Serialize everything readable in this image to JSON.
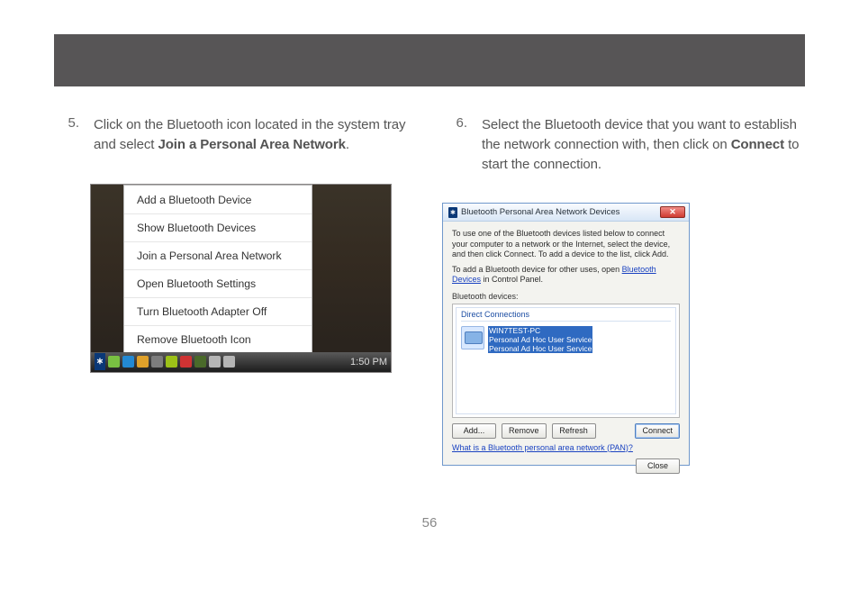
{
  "page_number": "56",
  "step5": {
    "num": "5.",
    "before": "Click on the Bluetooth icon located in the system tray and select ",
    "bold": "Join a Personal Area Network",
    "after": "."
  },
  "step6": {
    "num": "6.",
    "before": "Select the Bluetooth device that you want to establish the network connection with, then click on ",
    "bold": "Connect",
    "after": " to start the connection."
  },
  "context_menu": {
    "items": [
      "Add a Bluetooth Device",
      "Show Bluetooth Devices",
      "Join a Personal Area Network",
      "Open Bluetooth Settings",
      "Turn Bluetooth Adapter Off",
      "Remove Bluetooth Icon"
    ],
    "clock": "1:50 PM",
    "tray_colors": [
      "#79c042",
      "#2389d3",
      "#e0a12a",
      "#7d7d7d",
      "#9cc118",
      "#cf3333",
      "#4a6a2a",
      "#b5b5b5",
      "#b5b5b5"
    ]
  },
  "dialog": {
    "title": "Bluetooth Personal Area Network Devices",
    "intro1": "To use one of the Bluetooth devices listed below to connect your computer to a network or the Internet, select the device, and then click Connect. To add a device to the list, click Add.",
    "intro2_before": "To add a Bluetooth device for other uses, open ",
    "intro2_link": "Bluetooth Devices",
    "intro2_after": " in Control Panel.",
    "list_label": "Bluetooth devices:",
    "group_title": "Direct Connections",
    "device_name": "WIN7TEST-PC",
    "device_line2": "Personal Ad Hoc User Service",
    "device_line3": "Personal Ad Hoc User Service",
    "btn_add": "Add...",
    "btn_remove": "Remove",
    "btn_refresh": "Refresh",
    "btn_connect": "Connect",
    "help_link": "What is a Bluetooth personal area network (PAN)?",
    "btn_close": "Close"
  }
}
